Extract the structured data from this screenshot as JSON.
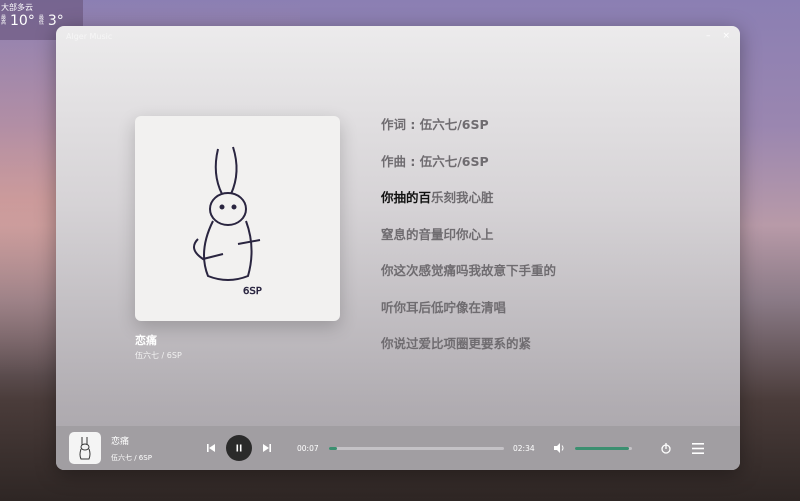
{
  "weather": {
    "condition": "大部多云",
    "high": "10°",
    "high_label": "最高",
    "low": "3°",
    "low_label": "最低"
  },
  "window": {
    "title": "Alger Music",
    "minimize": "–",
    "close": "×"
  },
  "song": {
    "title": "恋痛",
    "artist": "伍六七 / 6SP",
    "cover_signature": "6SP"
  },
  "lyrics": [
    {
      "sung": "作词 : 伍六七/6SP",
      "rest": ""
    },
    {
      "sung": "作曲 : 伍六七/6SP",
      "rest": ""
    },
    {
      "sung": "你抽的百",
      "rest": "乐刻我心脏",
      "current": true
    },
    {
      "sung": "",
      "rest": "窒息的音量印你心上"
    },
    {
      "sung": "",
      "rest": "你这次感觉痛吗我故意下手重的"
    },
    {
      "sung": "",
      "rest": "听你耳后低咛像在清唱"
    },
    {
      "sung": "",
      "rest": "你说过爱比项圈更要系的紧"
    }
  ],
  "player": {
    "current_time": "00:07",
    "total_time": "02:34",
    "progress": 0.045,
    "volume": 0.95,
    "accent": "#3b8f70"
  }
}
